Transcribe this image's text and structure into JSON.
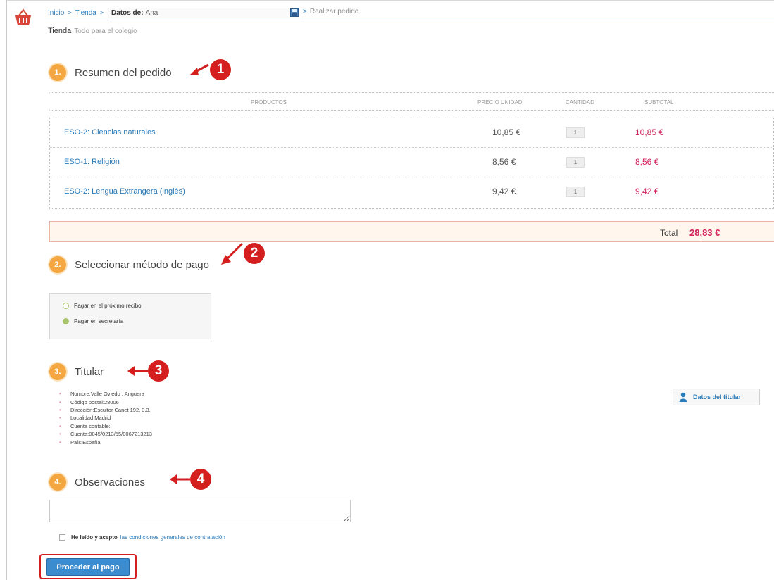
{
  "breadcrumb": {
    "items": [
      "Inicio",
      "Tienda"
    ],
    "datos_label": "Datos de:",
    "datos_value": "Ana",
    "last": "Realizar pedido"
  },
  "store": {
    "title": "Tienda",
    "subtitle": "Todo para el colegio"
  },
  "steps": [
    {
      "num": "1.",
      "title": "Resumen del pedido"
    },
    {
      "num": "2.",
      "title": "Seleccionar método de pago"
    },
    {
      "num": "3.",
      "title": "Titular"
    },
    {
      "num": "4.",
      "title": "Observaciones"
    }
  ],
  "callouts": [
    "1",
    "2",
    "3",
    "4"
  ],
  "table": {
    "headers": [
      "PRODUCTOS",
      "PRECIO UNIDAD",
      "CANTIDAD",
      "SUBTOTAL"
    ],
    "rows": [
      {
        "name": "ESO-2: Ciencias naturales",
        "price": "10,85 €",
        "qty": "1",
        "subtotal": "10,85 €"
      },
      {
        "name": "ESO-1: Religión",
        "price": "8,56 €",
        "qty": "1",
        "subtotal": "8,56 €"
      },
      {
        "name": "ESO-2: Lengua Extrangera (inglés)",
        "price": "9,42 €",
        "qty": "1",
        "subtotal": "9,42 €"
      }
    ],
    "total_label": "Total",
    "total_value": "28,83 €"
  },
  "payment": {
    "options": [
      "Pagar en el próximo recibo",
      "Pagar en secretaría"
    ],
    "selected": "Pagar en secretaría"
  },
  "holder": {
    "items": [
      "Nombre:Valle Oviedo , Anguera",
      "Código postal:28006",
      "Dirección:Escultor Canet 192, 3,3.",
      "Localidad:Madrid",
      "Cuenta contable:",
      "Cuenta:0045/0213/55/0067213213",
      "País:España"
    ],
    "button_label": "Datos del titular"
  },
  "observations": {
    "value": ""
  },
  "terms": {
    "text": "He leído y acepto",
    "link": "las condiciones generales de contratación"
  },
  "submit_label": "Proceder al pago",
  "colors": {
    "accent": "#f4a640",
    "link": "#2a7ab8",
    "price": "#d0215a",
    "callout": "#d51f1f",
    "button": "#3b8bcf"
  }
}
